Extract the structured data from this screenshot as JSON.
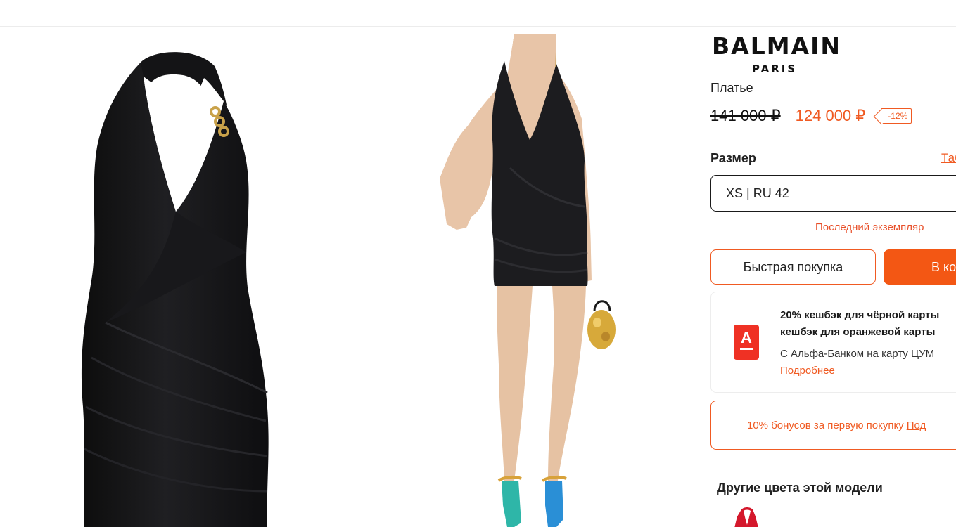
{
  "header": {
    "nav_icon": "cut-off-navigation-bar"
  },
  "gallery": {
    "images": [
      {
        "name": "product-flat-lay-image",
        "icon": "black-halter-dress"
      },
      {
        "name": "product-model-image",
        "icon": "model-in-black-dress"
      }
    ]
  },
  "product": {
    "brand": "BALMAIN",
    "brand_sub": "PARIS",
    "type": "Платье",
    "price_old": "141 000 ₽",
    "price_new": "124 000 ₽",
    "discount": "-12%"
  },
  "size": {
    "label": "Размер",
    "table_link": "Таб",
    "selected": "XS | RU 42",
    "stock_note": "Последний экземпляр"
  },
  "actions": {
    "quick_buy": "Быстрая покупка",
    "add_to_cart": "В ко"
  },
  "promo": {
    "bank_icon": "alfa-bank-logo",
    "line1": "20% кешбэк для чёрной карты",
    "line2": "кешбэк для оранжевой карты",
    "desc": "С Альфа-Банком на карту ЦУМ",
    "more": "Подробнее"
  },
  "bonus": {
    "text": "10% бонусов за первую покупку",
    "link": "Под"
  },
  "colors": {
    "title": "Другие цвета этой модели"
  },
  "theme": {
    "accent": "#f05a22",
    "cart_button": "#f35714",
    "alfa_red": "#ef3124"
  }
}
